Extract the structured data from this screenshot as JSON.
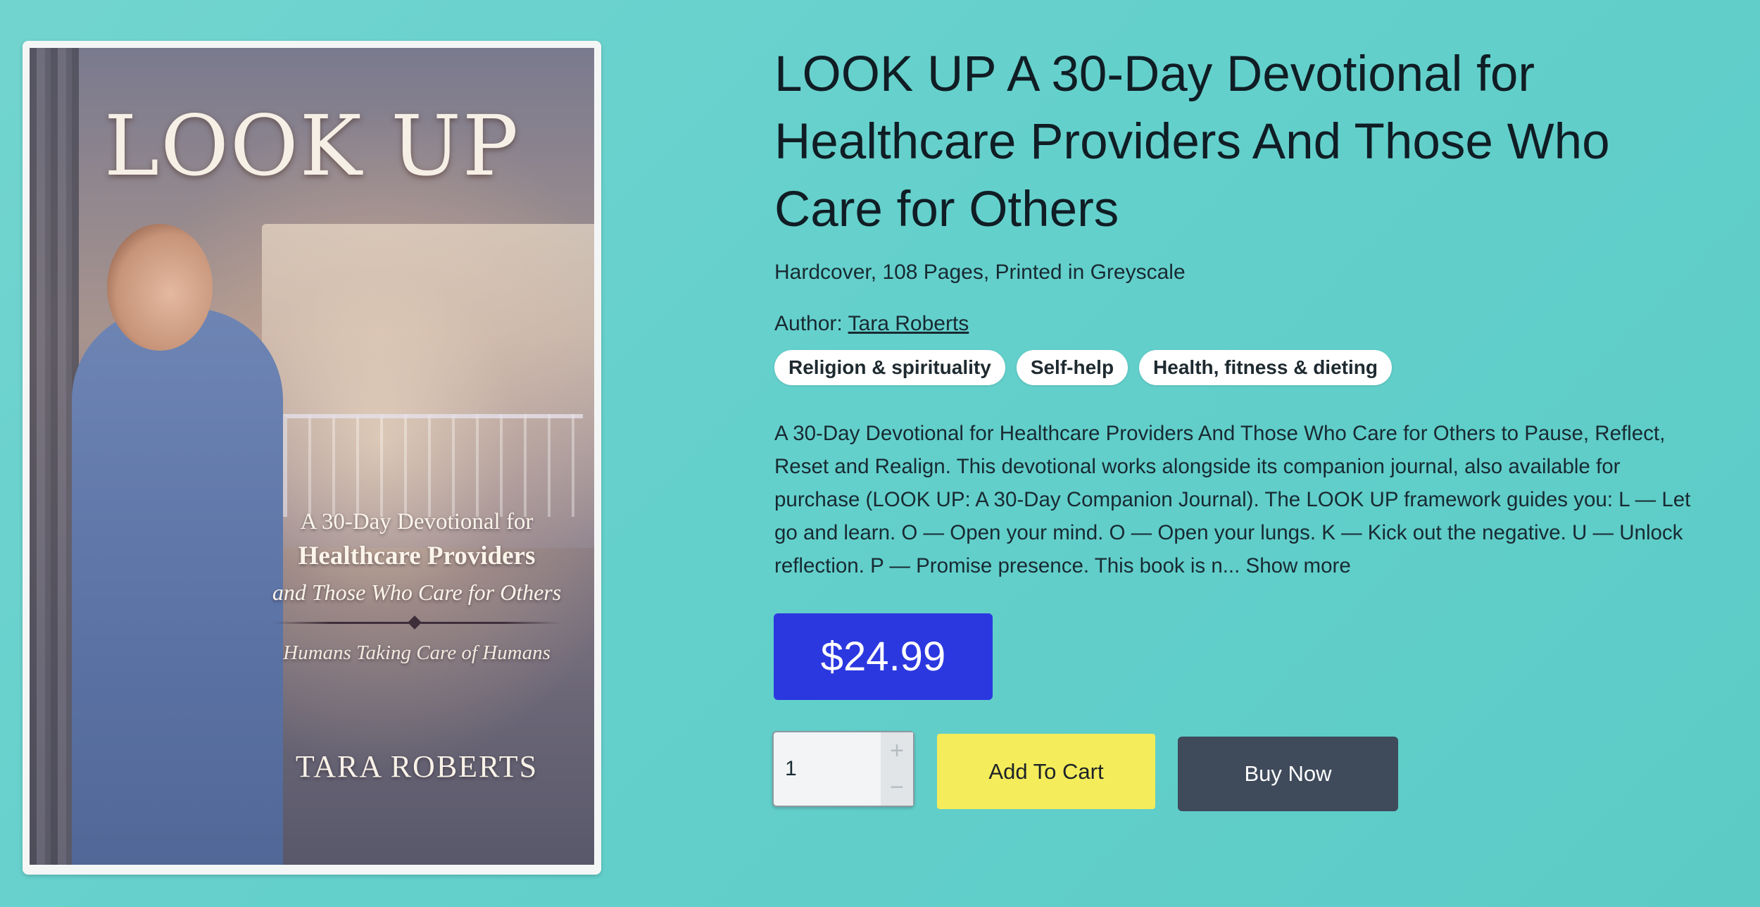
{
  "cover": {
    "title": "LOOK UP",
    "subtitle_line1": "A 30-Day Devotional for",
    "subtitle_line2": "Healthcare Providers",
    "subtitle_line3": "and Those Who Care for Others",
    "tagline": "Humans Taking Care of Humans",
    "author": "TARA ROBERTS"
  },
  "product": {
    "title": "LOOK UP A 30-Day Devotional for Healthcare Providers And Those Who Care for Others",
    "format": "Hardcover, 108 Pages, Printed in Greyscale",
    "author_label": "Author:",
    "author_name": "Tara Roberts",
    "tags": [
      "Religion & spirituality",
      "Self-help",
      "Health, fitness & dieting"
    ],
    "description": "A 30-Day Devotional for Healthcare Providers And Those Who Care for Others to Pause, Reflect, Reset and Realign. This devotional works alongside its companion journal, also available for purchase (LOOK UP: A 30-Day Companion Journal). The LOOK UP framework guides you: L — Let go and learn. O — Open your mind. O — Open your lungs. K — Kick out the negative. U — Unlock reflection. P — Promise presence. This book is n...",
    "show_more": "Show more",
    "price": "$24.99"
  },
  "purchase": {
    "quantity": "1",
    "plus_symbol": "+",
    "minus_symbol": "−",
    "add_to_cart": "Add To Cart",
    "buy_now": "Buy Now"
  },
  "colors": {
    "background": "#66d0cb",
    "price_bg": "#2b38e0",
    "add_to_cart_bg": "#f4ec5a",
    "buy_now_bg": "#3f4a5b"
  }
}
